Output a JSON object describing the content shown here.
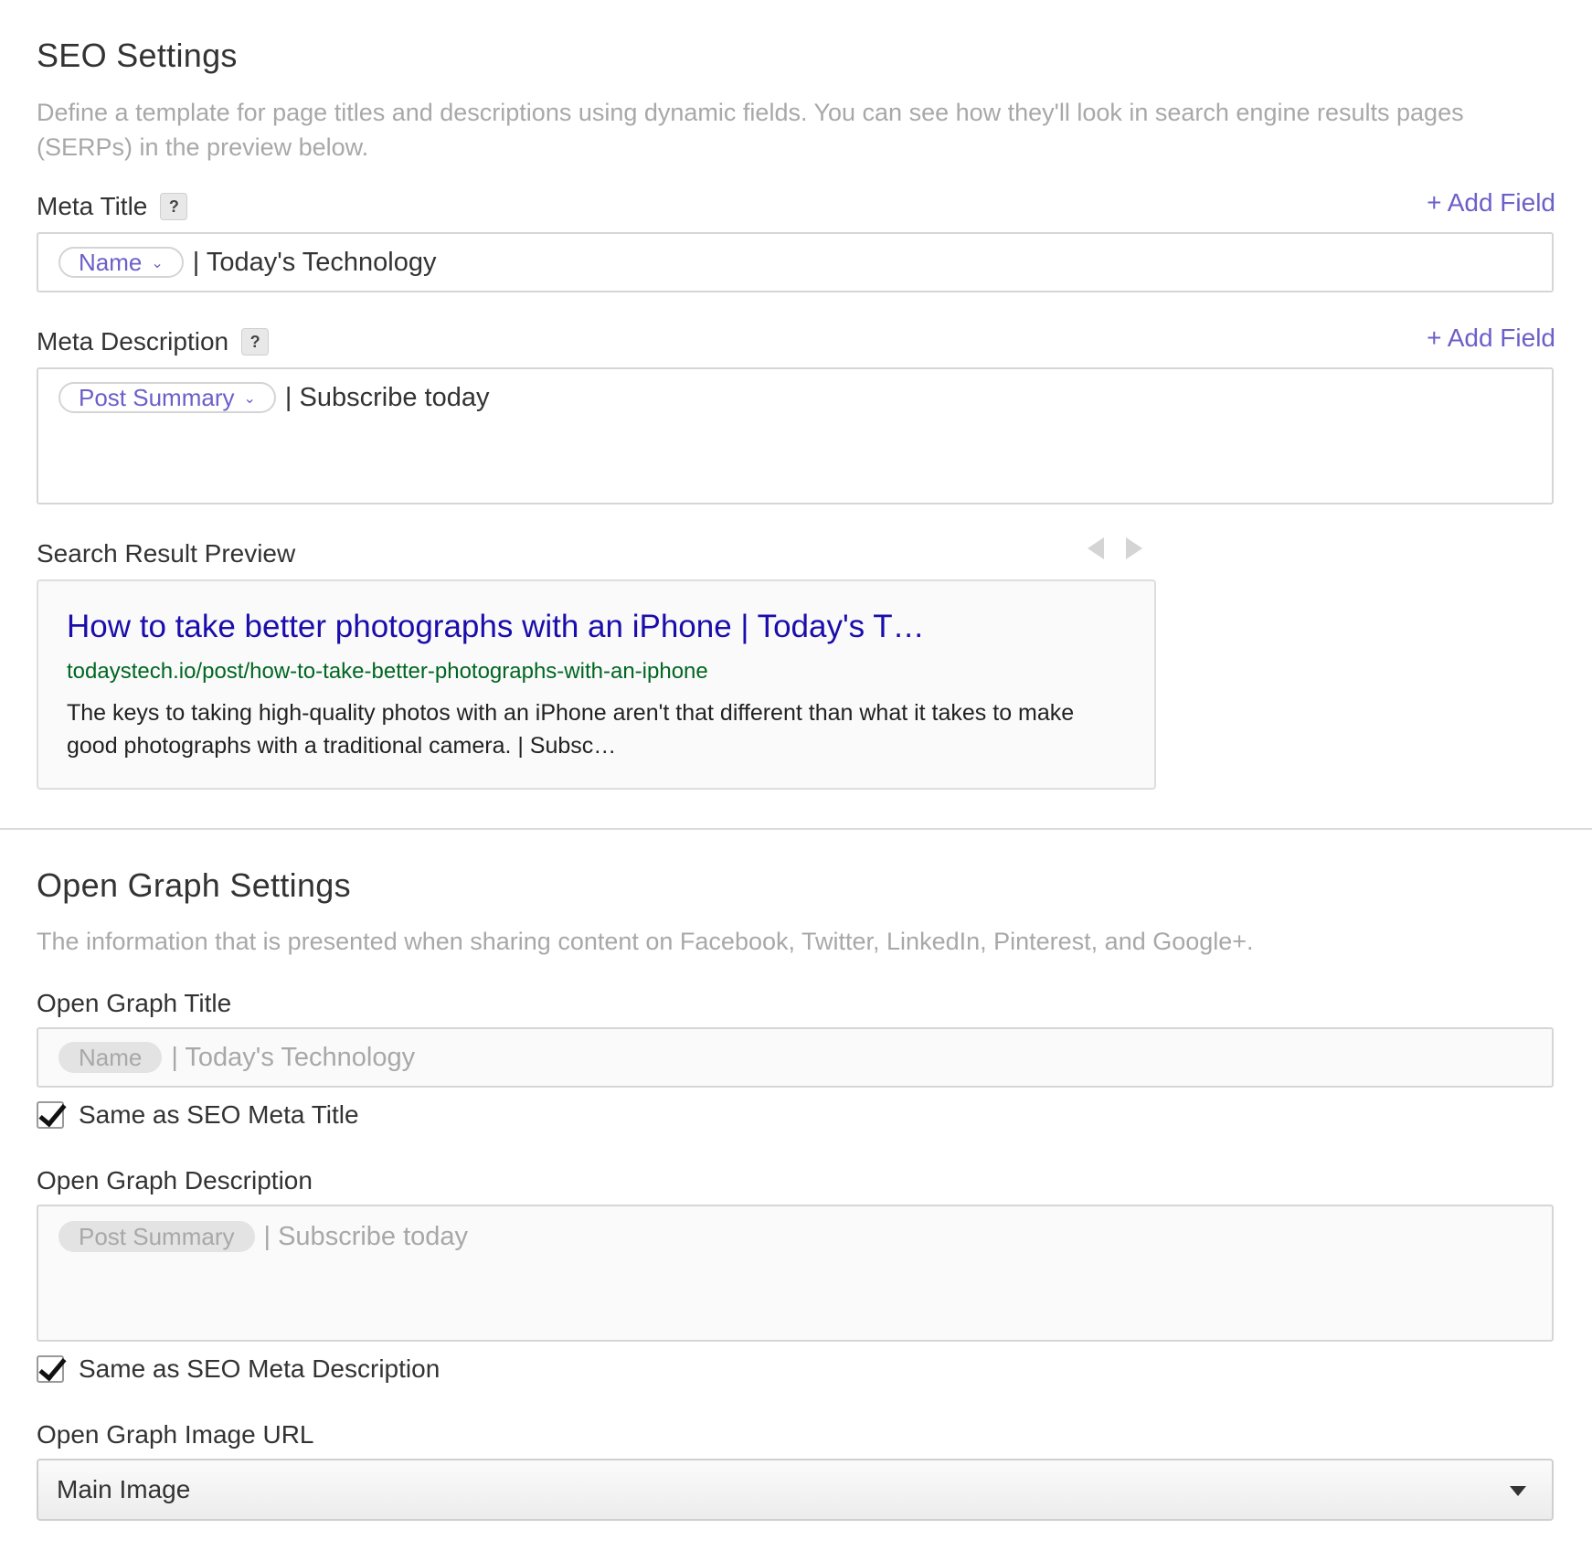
{
  "seo": {
    "heading": "SEO Settings",
    "description": "Define a template for page titles and descriptions using dynamic fields. You can see how they'll look in search engine results pages (SERPs) in the preview below.",
    "meta_title": {
      "label": "Meta Title",
      "help": "?",
      "add_field": "+ Add Field",
      "token": "Name",
      "suffix": "| Today's Technology"
    },
    "meta_description": {
      "label": "Meta Description",
      "help": "?",
      "add_field": "+ Add Field",
      "token": "Post Summary",
      "suffix": "| Subscribe today"
    },
    "preview": {
      "label": "Search Result Preview",
      "title": "How to take better photographs with an iPhone | Today's T…",
      "url": "todaystech.io/post/how-to-take-better-photographs-with-an-iphone",
      "description": "The keys to taking high-quality photos with an iPhone aren't that different than what it takes to make good photographs with a traditional camera. | Subsc…"
    }
  },
  "open_graph": {
    "heading": "Open Graph Settings",
    "description": "The information that is presented when sharing content on Facebook, Twitter, LinkedIn, Pinterest, and Google+.",
    "title": {
      "label": "Open Graph Title",
      "token": "Name",
      "suffix": "| Today's Technology",
      "same_as_label": "Same as SEO Meta Title",
      "same_as_checked": true
    },
    "description_field": {
      "label": "Open Graph Description",
      "token": "Post Summary",
      "suffix": "| Subscribe today",
      "same_as_label": "Same as SEO Meta Description",
      "same_as_checked": true
    },
    "image": {
      "label": "Open Graph Image URL",
      "selected": "Main Image"
    }
  },
  "colors": {
    "accent": "#6b5fc9",
    "link_title": "#1a0dab",
    "link_url": "#006621",
    "muted": "#a8a8a8"
  }
}
